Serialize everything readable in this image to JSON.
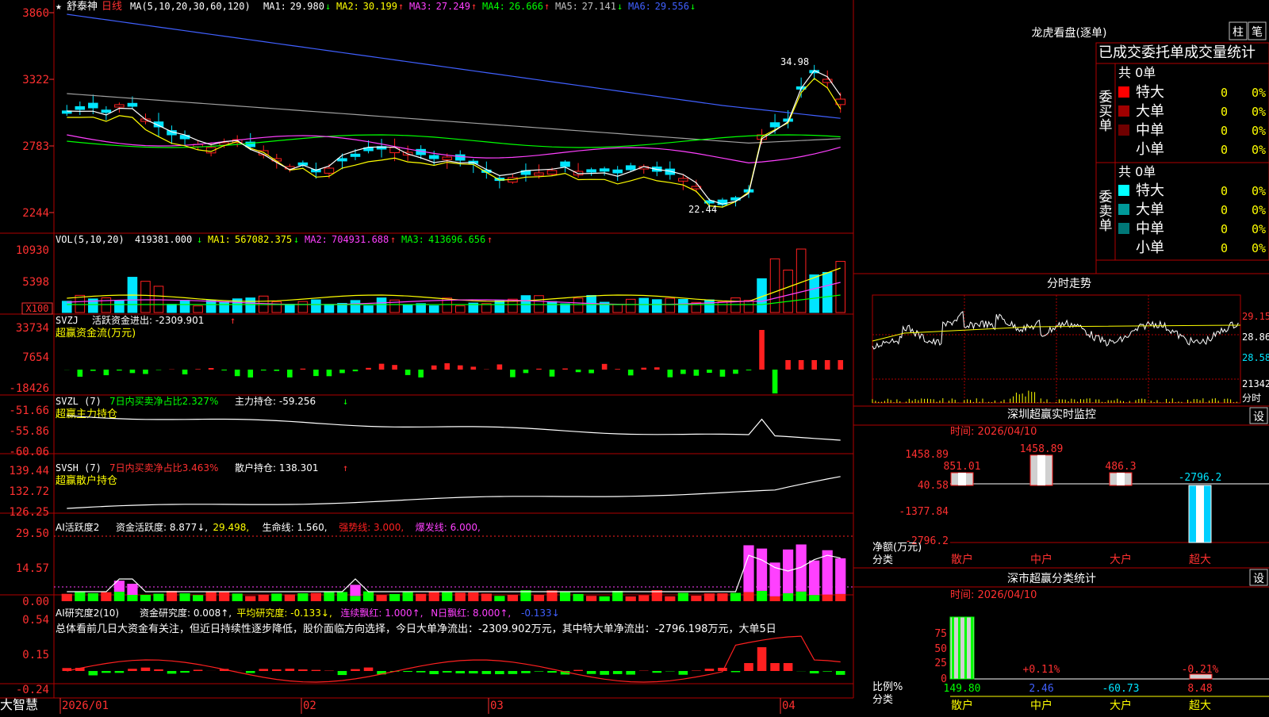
{
  "colors": {
    "up": "#ff2020",
    "down": "#00e5ff",
    "grid": "#b00000",
    "axis": "#ff3030",
    "white": "#ffffff",
    "yellow": "#ffff00",
    "magenta": "#ff40ff",
    "green": "#00ff00",
    "blue": "#4060ff",
    "gray": "#a0a0a0"
  },
  "header": {
    "star": "★",
    "stock_name": "舒泰神",
    "period": "日线",
    "ma_params": "MA(5,10,20,30,60,120)",
    "ma": [
      {
        "label": "MA1:",
        "value": "29.980",
        "trend": "↓",
        "color": "#ffffff"
      },
      {
        "label": "MA2:",
        "value": "30.199",
        "trend": "↑",
        "color": "#ffff00"
      },
      {
        "label": "MA3:",
        "value": "27.249",
        "trend": "↑",
        "color": "#ff40ff"
      },
      {
        "label": "MA4:",
        "value": "26.666",
        "trend": "↑",
        "color": "#00ff00"
      },
      {
        "label": "MA5:",
        "value": "27.141",
        "trend": "↓",
        "color": "#c0c0c0"
      },
      {
        "label": "MA6:",
        "value": "29.556",
        "trend": "↓",
        "color": "#4060ff"
      }
    ]
  },
  "price_panel": {
    "y_ticks": [
      "3860",
      "3322",
      "2783",
      "2244"
    ],
    "high_label": "34.98",
    "low_label": "22.44"
  },
  "vol_panel": {
    "params": "VOL(5,10,20)",
    "value": "419381.000",
    "value_trend": "↓",
    "ma": [
      {
        "label": "MA1:",
        "value": "567082.375",
        "trend": "↓",
        "color": "#ffff00"
      },
      {
        "label": "MA2:",
        "value": "704931.688",
        "trend": "↑",
        "color": "#ff40ff"
      },
      {
        "label": "MA3:",
        "value": "413696.656",
        "trend": "↑",
        "color": "#00ff00"
      }
    ],
    "y_ticks": [
      "10930",
      "5398"
    ],
    "unit": "X100"
  },
  "svzj_panel": {
    "name": "SVZJ",
    "text": "活跃资金进出: -2309.901",
    "trend": "↑",
    "subtitle": "超赢资金流(万元)",
    "y_ticks": [
      "33734",
      "7654",
      "-18426"
    ]
  },
  "svzl_panel": {
    "name": "SVZL (7)",
    "text1": "7日内买卖净占比2.327%",
    "text2": "主力持仓: -59.256",
    "trend": "↓",
    "subtitle": "超赢主力持仓",
    "y_ticks": [
      "-51.66",
      "-55.86",
      "-60.06"
    ]
  },
  "svsh_panel": {
    "name": "SVSH (7)",
    "text1": "7日内买卖净占比3.463%",
    "text2": "散户持仓: 138.301",
    "trend": "↑",
    "subtitle": "超赢散户持仓",
    "y_ticks": [
      "139.44",
      "132.72",
      "126.25"
    ]
  },
  "ai1_panel": {
    "name": "AI活跃度2",
    "items": [
      {
        "text": "资金活跃度: 8.877↓,",
        "color": "#ffffff"
      },
      {
        "text": "29.498,",
        "color": "#ffff00"
      },
      {
        "text": "生命线: 1.560,",
        "color": "#ffffff"
      },
      {
        "text": "强势线: 3.000,",
        "color": "#ff2020"
      },
      {
        "text": "爆发线: 6.000,",
        "color": "#ff40ff"
      }
    ],
    "y_ticks": [
      "29.50",
      "14.57",
      "0.00"
    ]
  },
  "ai2_panel": {
    "name": "AI研究度2(10)",
    "items": [
      {
        "text": "资金研究度: 0.008↑,",
        "color": "#ffffff"
      },
      {
        "text": "平均研究度: -0.133↓,",
        "color": "#ffff00"
      },
      {
        "text": "连续飘红: 1.000↑,",
        "color": "#ff40ff"
      },
      {
        "text": "N日飘红: 8.000↑,",
        "color": "#ff40ff"
      },
      {
        "text": "-0.133↓",
        "color": "#4060ff"
      }
    ],
    "summary": "总体看前几日大资金有关注，但近日持续性逐步降低，股价面临方向选择，今日大单净流出：-2309.902万元，其中特大单净流出：-2796.198万元，大单5日",
    "y_ticks": [
      "0.54",
      "0.15",
      "-0.24"
    ]
  },
  "x_axis": {
    "logo": "大智慧",
    "labels": [
      "2026/01",
      "02",
      "03",
      "04"
    ]
  },
  "right": {
    "dragon": {
      "title": "龙虎看盘(逐单)",
      "btn1": "柱",
      "btn2": "笔",
      "header": "已成交委托单成交量统计",
      "buy_title": "委买单",
      "sell_title": "委卖单",
      "buy_total": "共 0单",
      "sell_total": "共 0单",
      "buy_rows": [
        {
          "label": "特大",
          "count": "0",
          "pct": "0%",
          "color": "#ff0000"
        },
        {
          "label": "大单",
          "count": "0",
          "pct": "0%",
          "color": "#a00000"
        },
        {
          "label": "中单",
          "count": "0",
          "pct": "0%",
          "color": "#700000"
        },
        {
          "label": "小单",
          "count": "0",
          "pct": "0%",
          "color": ""
        }
      ],
      "sell_rows": [
        {
          "label": "特大",
          "count": "0",
          "pct": "0%",
          "color": "#00ffff"
        },
        {
          "label": "大单",
          "count": "0",
          "pct": "0%",
          "color": "#009999"
        },
        {
          "label": "中单",
          "count": "0",
          "pct": "0%",
          "color": "#007777"
        },
        {
          "label": "小单",
          "count": "0",
          "pct": "0%",
          "color": ""
        }
      ]
    },
    "intraday": {
      "title": "分时走势",
      "price_ticks": [
        "29.15",
        "28.86",
        "28.58"
      ],
      "vol_tick": "21342",
      "vol_unit": "分时"
    },
    "monitor": {
      "title": "深圳超赢实时监控",
      "set": "设",
      "time": "时间: 2026/04/10",
      "y_ticks": [
        "1458.89",
        "40.58",
        "-1377.84",
        "-2796.2"
      ],
      "unit1": "净额(万元)",
      "unit2": "分类",
      "categories": [
        "散户",
        "中户",
        "大户",
        "超大"
      ],
      "values": [
        851.01,
        1458.89,
        486.3,
        -2796.2
      ],
      "value_labels": [
        "851.01",
        "1458.89",
        "486.3",
        "-2796.2"
      ]
    },
    "stats": {
      "title": "深市超赢分类统计",
      "set": "设",
      "time": "时间: 2026/04/10",
      "y_ticks": [
        "75",
        "50",
        "25",
        "0"
      ],
      "unit1": "比例%",
      "unit2": "分类",
      "categories": [
        "散户",
        "中户",
        "大户",
        "超大"
      ],
      "values": [
        149.8,
        2.46,
        -60.73,
        8.48
      ],
      "pct_labels": [
        "",
        "+0.11%",
        "",
        "-0.21%"
      ]
    }
  },
  "chart_data": [
    {
      "type": "candlestick",
      "title": "舒泰神 日线",
      "x_labels": [
        "2026/01",
        "02",
        "03",
        "04"
      ],
      "y_ticks": [
        3860,
        3322,
        2783,
        2244
      ],
      "high_marker": 34.98,
      "low_marker": 22.44,
      "series": [
        {
          "name": "MA1",
          "last": 29.98
        },
        {
          "name": "MA2",
          "last": 30.199
        },
        {
          "name": "MA3",
          "last": 27.249
        },
        {
          "name": "MA4",
          "last": 26.666
        },
        {
          "name": "MA5",
          "last": 27.141
        },
        {
          "name": "MA6",
          "last": 29.556
        }
      ]
    },
    {
      "type": "bar",
      "title": "VOL(5,10,20)",
      "last": 419381.0,
      "y_ticks": [
        10930,
        5398
      ]
    },
    {
      "type": "bar",
      "title": "SVZJ",
      "last": -2309.901,
      "y_ticks": [
        33734,
        7654,
        -18426
      ]
    },
    {
      "type": "bar",
      "title": "深圳超赢实时监控",
      "categories": [
        "散户",
        "中户",
        "大户",
        "超大"
      ],
      "values": [
        851.01,
        1458.89,
        486.3,
        -2796.2
      ]
    },
    {
      "type": "bar",
      "title": "深市超赢分类统计",
      "categories": [
        "散户",
        "中户",
        "大户",
        "超大"
      ],
      "values": [
        149.8,
        2.46,
        -60.73,
        8.48
      ]
    }
  ]
}
